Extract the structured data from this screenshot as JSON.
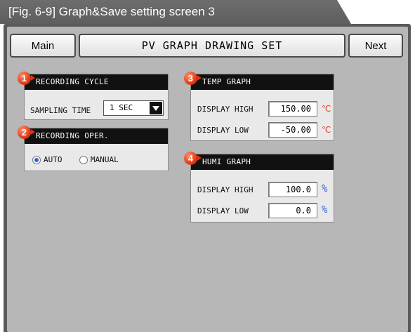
{
  "figure_caption": "[Fig. 6-9] Graph&Save setting screen 3",
  "toolbar": {
    "main_label": "Main",
    "title": "PV GRAPH DRAWING SET",
    "next_label": "Next"
  },
  "recording_cycle": {
    "badge": "1",
    "header": "RECORDING CYCLE",
    "sampling_label": "SAMPLING TIME",
    "sampling_value": "1 SEC"
  },
  "recording_oper": {
    "badge": "2",
    "header": "RECORDING OPER.",
    "options": [
      {
        "label": "AUTO",
        "selected": true
      },
      {
        "label": "MANUAL",
        "selected": false
      }
    ]
  },
  "temp_graph": {
    "badge": "3",
    "header": "TEMP GRAPH",
    "high_label": "DISPLAY HIGH",
    "high_value": "150.00",
    "low_label": "DISPLAY LOW",
    "low_value": "-50.00",
    "unit": "℃"
  },
  "humi_graph": {
    "badge": "4",
    "header": "HUMI GRAPH",
    "high_label": "DISPLAY HIGH",
    "high_value": "100.0",
    "low_label": "DISPLAY LOW",
    "low_value": "0.0",
    "unit": "%"
  },
  "colors": {
    "badge": "#e0320a",
    "header_bg": "#111111",
    "celsius": "#e23a2a",
    "percent": "#2a5fcf",
    "radio_dot": "#2d63d6"
  }
}
